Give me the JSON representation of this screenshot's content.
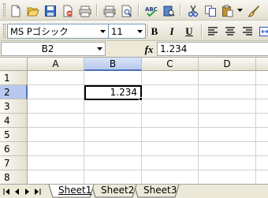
{
  "toolbar": {
    "font_name": "MS Pゴシック",
    "font_size": "11",
    "bold_label": "B",
    "italic_label": "I",
    "underline_label": "U"
  },
  "formula_bar": {
    "name_box": "B2",
    "fx_label": "fx",
    "formula": "1.234"
  },
  "grid": {
    "columns": [
      "A",
      "B",
      "C",
      "D"
    ],
    "selected_column": "B",
    "rows": [
      "1",
      "2",
      "3",
      "4",
      "5",
      "6",
      "7",
      "8"
    ],
    "selected_row": "2",
    "active_cell_value": "1.234"
  },
  "sheet_tabs": [
    "Sheet1",
    "Sheet2",
    "Sheet3"
  ],
  "active_sheet": "Sheet1",
  "colors": {
    "selection_header": "#b7c9ee",
    "chrome": "#ece9d8",
    "gridline": "#d4d0c8"
  }
}
